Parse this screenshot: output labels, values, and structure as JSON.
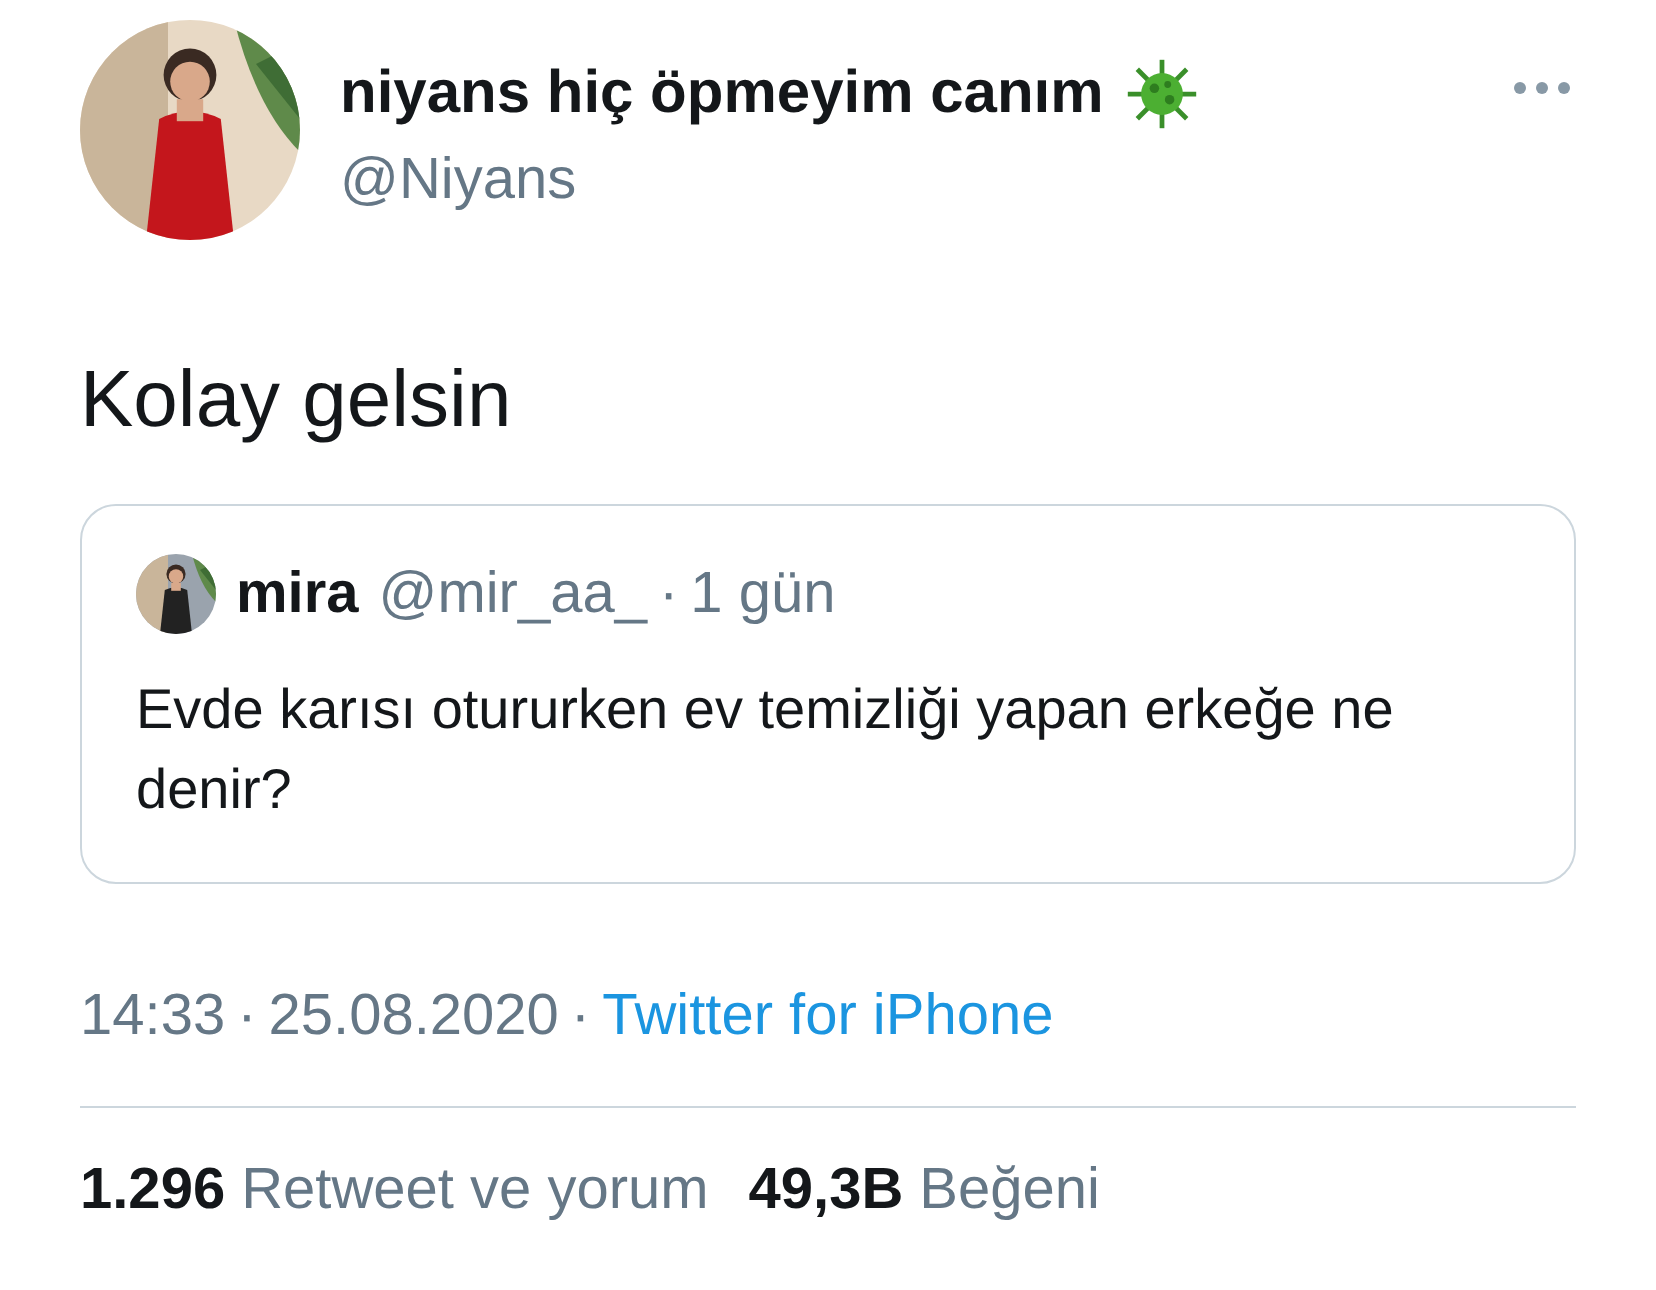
{
  "author": {
    "name": "niyans hiç öpmeyim canım",
    "handle": "@Niyans"
  },
  "tweet_text": "Kolay gelsin",
  "quoted": {
    "name": "mira",
    "handle": "@mir_aa_",
    "separator": "·",
    "age": "1 gün",
    "text": "Evde karısı otururken ev temizliği yapan erkeğe ne denir?"
  },
  "meta": [
    {
      "kind": "text",
      "text": "14:33"
    },
    {
      "kind": "sep",
      "text": "·"
    },
    {
      "kind": "text",
      "text": "25.08.2020"
    },
    {
      "kind": "sep",
      "text": "·"
    },
    {
      "kind": "link",
      "text": "Twitter for iPhone"
    }
  ],
  "stats": [
    {
      "count": "1.296",
      "label": "Retweet ve yorum"
    },
    {
      "count": "49,3B",
      "label": "Beğeni"
    }
  ]
}
